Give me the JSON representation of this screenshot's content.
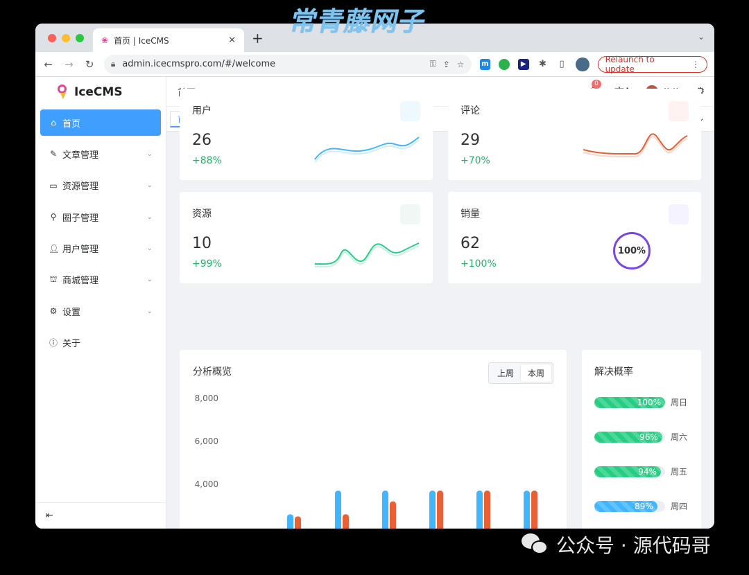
{
  "watermark": {
    "top": "常青藤网子",
    "bottom": "公众号 · 源代码哥"
  },
  "browser": {
    "tab_title": "首页 | IceCMS",
    "new_tab": "+",
    "url": "admin.icecmspro.com/#/welcome",
    "relaunch_label": "Relaunch to update"
  },
  "app": {
    "name": "IceCMS"
  },
  "sidebar": {
    "items": [
      {
        "label": "首页",
        "icon": "home-icon",
        "active": true,
        "has_children": false
      },
      {
        "label": "文章管理",
        "icon": "edit-icon",
        "active": false,
        "has_children": true
      },
      {
        "label": "资源管理",
        "icon": "folder-icon",
        "active": false,
        "has_children": true
      },
      {
        "label": "圈子管理",
        "icon": "search-key-icon",
        "active": false,
        "has_children": true
      },
      {
        "label": "用户管理",
        "icon": "user-icon",
        "active": false,
        "has_children": true
      },
      {
        "label": "商城管理",
        "icon": "shop-icon",
        "active": false,
        "has_children": true
      },
      {
        "label": "设置",
        "icon": "gear-icon",
        "active": false,
        "has_children": true
      },
      {
        "label": "关于",
        "icon": "info-icon",
        "active": false,
        "has_children": false
      }
    ]
  },
  "header": {
    "breadcrumb": "首页",
    "notification_count": "0",
    "username": "悠悠"
  },
  "tags": {
    "active": "首页"
  },
  "stats": [
    {
      "title": "用户",
      "value": "26",
      "growth": "+88%",
      "color": "#41b6ff",
      "chip": "#eef8ff"
    },
    {
      "title": "评论",
      "value": "29",
      "growth": "+70%",
      "color": "#e85f33",
      "chip": "#fff2f0"
    },
    {
      "title": "资源",
      "value": "10",
      "growth": "+99%",
      "color": "#26ce83",
      "chip": "#eff8f4"
    },
    {
      "title": "销量",
      "value": "62",
      "growth": "+100%",
      "color": "#7846e5",
      "chip": "#f5f3ff",
      "ring_label": "100%"
    }
  ],
  "analysis": {
    "title": "分析概览",
    "tabs": [
      "上周",
      "本周"
    ],
    "active_tab": "本周"
  },
  "chart_data": {
    "type": "bar",
    "ylim": [
      0,
      8000
    ],
    "y_ticks": [
      "8,000",
      "6,000",
      "4,000"
    ],
    "y_tick_values": [
      8000,
      6000,
      4000
    ],
    "series": [
      {
        "color": "#41b6ff",
        "values": [
          2600,
          3700,
          3700,
          3700,
          3700,
          3700
        ]
      },
      {
        "color": "#e86033",
        "values": [
          2500,
          2600,
          3200,
          3700,
          3700,
          3700
        ]
      }
    ]
  },
  "solve_rate": {
    "title": "解决概率",
    "rows": [
      {
        "label": "100%",
        "value": 100,
        "day": "周日",
        "color": "#26ce83"
      },
      {
        "label": "96%",
        "value": 96,
        "day": "周六",
        "color": "#26ce83"
      },
      {
        "label": "94%",
        "value": 94,
        "day": "周五",
        "color": "#26ce83"
      },
      {
        "label": "89%",
        "value": 89,
        "day": "周四",
        "color": "#41b6ff"
      }
    ]
  }
}
